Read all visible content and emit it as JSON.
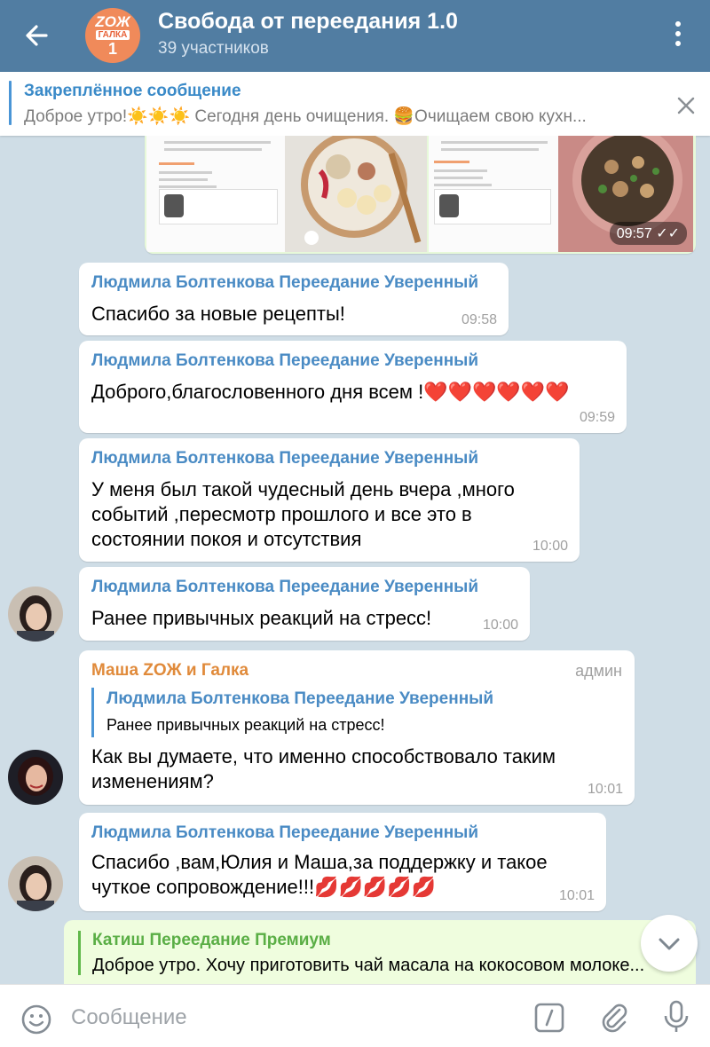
{
  "header": {
    "title": "Свобода от переедания 1.0",
    "subtitle": "39 участников",
    "avatar": {
      "line1": "ZOЖ",
      "line2": "ГАЛКА",
      "line3": "1"
    }
  },
  "pinned": {
    "title": "Закреплённое сообщение",
    "text": "Доброе утро!☀️☀️☀️  Сегодня день очищения. 🍔Очищаем свою кухн..."
  },
  "photo_message": {
    "time": "09:57"
  },
  "messages": [
    {
      "sender": "Людмила Болтенкова Переедание Уверенный",
      "text": "Спасибо за новые рецепты!",
      "time": "09:58"
    },
    {
      "sender": "Людмила Болтенкова Переедание Уверенный",
      "text": "Доброго,благословенного дня всем !❤️❤️❤️❤️❤️❤️",
      "time": "09:59"
    },
    {
      "sender": "Людмила Болтенкова Переедание Уверенный",
      "text_lines": [
        "У меня был такой чудесный день вчера ,много",
        "событий ,пересмотр прошлого и все это в",
        "состоянии покоя и отсутствия"
      ],
      "time": "10:00"
    },
    {
      "sender": "Людмила Болтенкова Переедание Уверенный",
      "text": "Ранее привычных реакций на стресс!",
      "time": "10:00"
    },
    {
      "sender": "Маша ZОЖ и Галка",
      "badge": "админ",
      "reply": {
        "name": "Людмила Болтенкова Переедание Уверенный",
        "text": "Ранее привычных реакций на стресс!"
      },
      "text_lines": [
        "Как вы думаете, что именно способствовало таким",
        "изменениям?"
      ],
      "time": "10:01"
    },
    {
      "sender": "Людмила Болтенкова Переедание Уверенный",
      "text_lines": [
        "Спасибо ,вам,Юлия и Маша,за поддержку и такое",
        "чуткое сопровождение!!!💋💋💋💋💋"
      ],
      "time": "10:01"
    }
  ],
  "outgoing_reply": {
    "name": "Катиш Переедание Премиум",
    "text": "Доброе утро. Хочу приготовить чай масала на кокосовом молоке..."
  },
  "input": {
    "placeholder": "Сообщение"
  },
  "icons": [
    "back-arrow-icon",
    "more-vert-icon",
    "close-icon",
    "emoji-icon",
    "command-icon",
    "attach-icon",
    "mic-icon",
    "chevron-down-icon"
  ]
}
